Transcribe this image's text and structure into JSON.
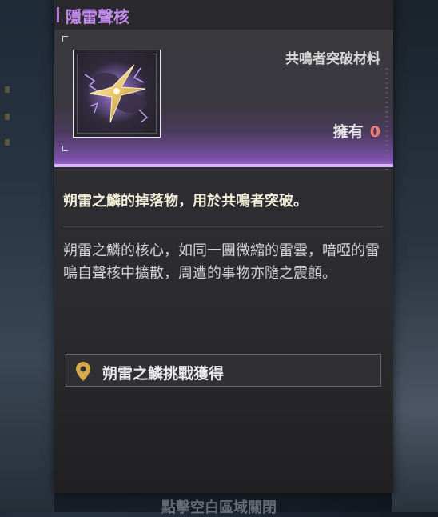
{
  "item": {
    "title": "隱雷聲核",
    "category": "共鳴者突破材料",
    "owned_label": "擁有",
    "owned_count": "0",
    "short_description": "朔雷之鱗的掉落物，用於共鳴者突破。",
    "long_description": "朔雷之鱗的核心，如同一團微縮的雷雲，喑啞的雷鳴自聲核中擴散，周遭的事物亦隨之震顫。",
    "source_label": "朔雷之鱗挑戰獲得",
    "icon": "lightning-core-icon"
  },
  "background": {
    "bottom_hint": "點擊空白區域關閉"
  },
  "colors": {
    "title": "#c58cf0",
    "accent_line": "#d9b4ff",
    "owned_count": "#ff7a6e",
    "pin": "#d6a84a"
  }
}
